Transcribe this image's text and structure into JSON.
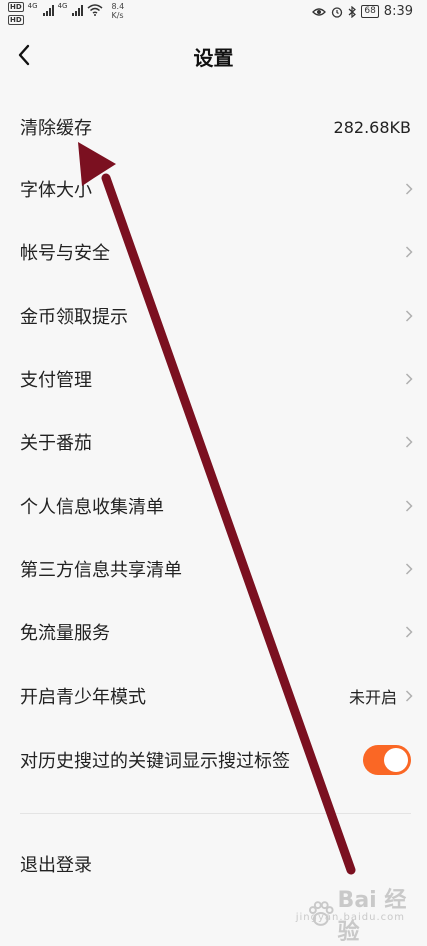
{
  "status_bar": {
    "hd1": "HD",
    "hd2": "HD",
    "net1": "4G",
    "net2": "4G",
    "speed_value": "8.4",
    "speed_unit": "K/s",
    "battery": "68",
    "time": "8:39"
  },
  "header": {
    "title": "设置"
  },
  "rows": [
    {
      "label": "清除缓存",
      "value": "282.68KB"
    },
    {
      "label": "字体大小"
    },
    {
      "label": "帐号与安全"
    },
    {
      "label": "金币领取提示"
    },
    {
      "label": "支付管理"
    },
    {
      "label": "关于番茄"
    },
    {
      "label": "个人信息收集清单"
    },
    {
      "label": "第三方信息共享清单"
    },
    {
      "label": "免流量服务"
    },
    {
      "label": "开启青少年模式",
      "value": "未开启"
    },
    {
      "label": "对历史搜过的关键词显示搜过标签",
      "toggle_on": true
    }
  ],
  "logout": {
    "label": "退出登录"
  },
  "watermark": {
    "text": "Bai 经验",
    "sub": "jingyan.baidu.com"
  },
  "colors": {
    "accent": "#fa6725",
    "arrow": "#7b1020",
    "background": "#f7f7f7"
  }
}
